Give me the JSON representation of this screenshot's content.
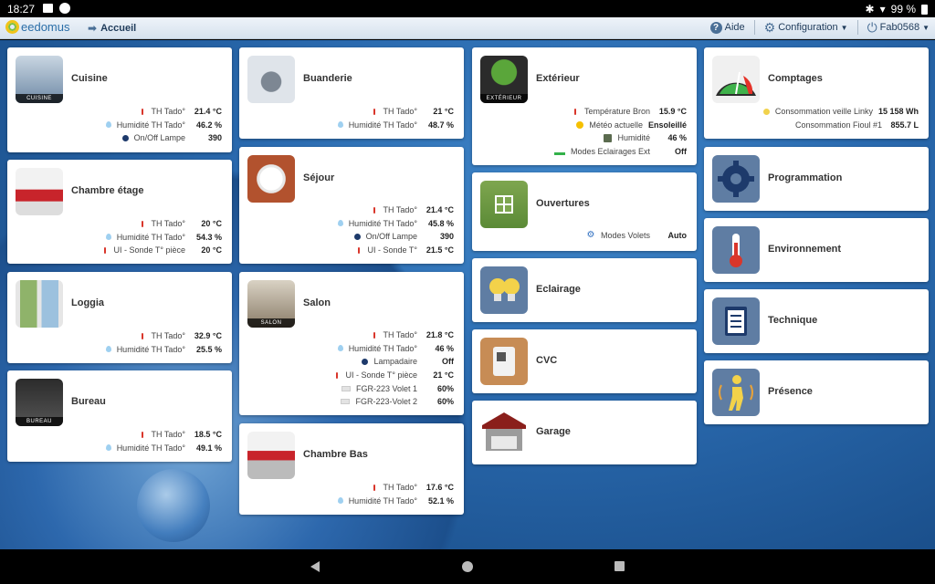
{
  "status_bar": {
    "time": "18:27",
    "battery": "99 %"
  },
  "app_bar": {
    "logo_text": "eedomus",
    "breadcrumb": "Accueil",
    "help_label": "Aide",
    "config_label": "Configuration",
    "user_label": "Fab0568"
  },
  "cards": {
    "cuisine": {
      "title": "Cuisine",
      "caption": "CUISINE",
      "rows": [
        {
          "label": "TH Tado°",
          "value": "21.4 °C"
        },
        {
          "label": "Humidité TH Tado°",
          "value": "46.2 %"
        },
        {
          "label": "On/Off Lampe",
          "value": "390"
        }
      ]
    },
    "chambre_etage": {
      "title": "Chambre étage",
      "rows": [
        {
          "label": "TH Tado°",
          "value": "20 °C"
        },
        {
          "label": "Humidité TH Tado°",
          "value": "54.3 %"
        },
        {
          "label": "UI - Sonde T° pièce",
          "value": "20 °C"
        }
      ]
    },
    "loggia": {
      "title": "Loggia",
      "rows": [
        {
          "label": "TH Tado°",
          "value": "32.9 °C"
        },
        {
          "label": "Humidité TH Tado°",
          "value": "25.5 %"
        }
      ]
    },
    "bureau": {
      "title": "Bureau",
      "caption": "BUREAU",
      "rows": [
        {
          "label": "TH Tado°",
          "value": "18.5 °C"
        },
        {
          "label": "Humidité TH Tado°",
          "value": "49.1 %"
        }
      ]
    },
    "buanderie": {
      "title": "Buanderie",
      "rows": [
        {
          "label": "TH Tado°",
          "value": "21 °C"
        },
        {
          "label": "Humidité TH Tado°",
          "value": "48.7 %"
        }
      ]
    },
    "sejour": {
      "title": "Séjour",
      "rows": [
        {
          "label": "TH Tado°",
          "value": "21.4 °C"
        },
        {
          "label": "Humidité TH Tado°",
          "value": "45.8 %"
        },
        {
          "label": "On/Off Lampe",
          "value": "390"
        },
        {
          "label": "UI - Sonde T°",
          "value": "21.5 °C"
        }
      ]
    },
    "salon": {
      "title": "Salon",
      "caption": "SALON",
      "rows": [
        {
          "label": "TH Tado°",
          "value": "21.8 °C"
        },
        {
          "label": "Humidité TH Tado°",
          "value": "46 %"
        },
        {
          "label": "Lampadaire",
          "value": "Off"
        },
        {
          "label": "UI - Sonde T° pièce",
          "value": "21 °C"
        },
        {
          "label": "FGR-223 Volet 1",
          "value": "60%"
        },
        {
          "label": "FGR-223-Volet 2",
          "value": "60%"
        }
      ]
    },
    "chambre_bas": {
      "title": "Chambre Bas",
      "rows": [
        {
          "label": "TH Tado°",
          "value": "17.6 °C"
        },
        {
          "label": "Humidité TH Tado°",
          "value": "52.1 %"
        }
      ]
    },
    "exterieur": {
      "title": "Extérieur",
      "caption": "EXTÉRIEUR",
      "rows": [
        {
          "label": "Température Bron",
          "value": "15.9 °C"
        },
        {
          "label": "Météo actuelle",
          "value": "Ensoleillé"
        },
        {
          "label": "Humidité",
          "value": "46 %"
        },
        {
          "label": "Modes Eclairages Ext",
          "value": "Off"
        }
      ]
    },
    "ouvertures": {
      "title": "Ouvertures",
      "rows": [
        {
          "label": "Modes Volets",
          "value": "Auto"
        }
      ]
    },
    "eclairage": {
      "title": "Eclairage"
    },
    "cvc": {
      "title": "CVC"
    },
    "garage": {
      "title": "Garage"
    },
    "comptages": {
      "title": "Comptages",
      "rows": [
        {
          "label": "Consommation veille Linky",
          "value": "15 158 Wh"
        },
        {
          "label": "Consommation Fioul #1",
          "value": "855.7 L"
        }
      ]
    },
    "programmation": {
      "title": "Programmation"
    },
    "environnement": {
      "title": "Environnement"
    },
    "technique": {
      "title": "Technique"
    },
    "presence": {
      "title": "Présence"
    }
  }
}
